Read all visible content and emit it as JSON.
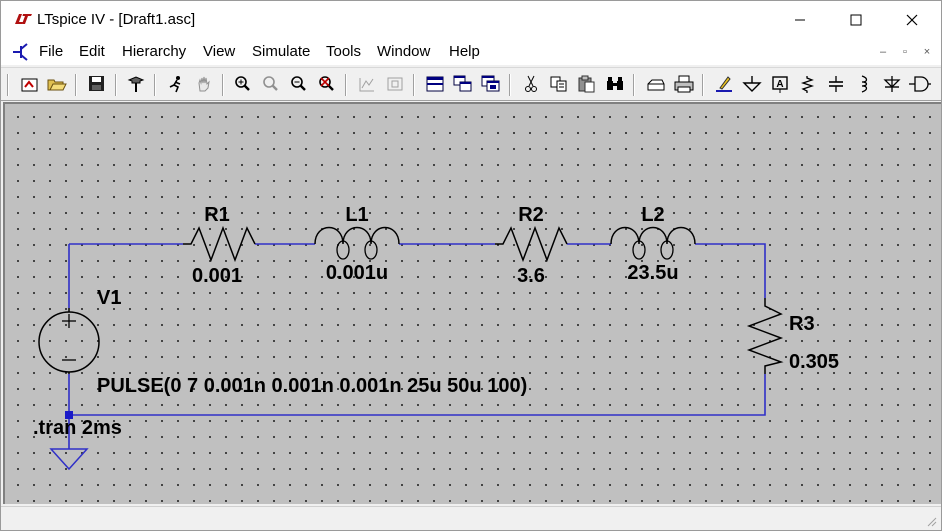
{
  "window": {
    "title": "LTspice IV - [Draft1.asc]"
  },
  "window_controls": {
    "minimize": "—",
    "maximize": "☐",
    "close": "✕"
  },
  "menu": {
    "items": [
      {
        "label": "File"
      },
      {
        "label": "Edit"
      },
      {
        "label": "Hierarchy"
      },
      {
        "label": "View"
      },
      {
        "label": "Simulate"
      },
      {
        "label": "Tools"
      },
      {
        "label": "Window"
      },
      {
        "label": "Help"
      }
    ],
    "mdi_controls": {
      "minimize": "–",
      "restore": "▫",
      "close": "×"
    }
  },
  "toolbar": {
    "icons": [
      "new-schematic-icon",
      "open-icon",
      "save-icon",
      "control-panel-icon",
      "run-icon",
      "halt-icon",
      "zoom-in-icon",
      "zoom-pan-icon",
      "zoom-out-icon",
      "zoom-fit-icon",
      "autorange-icon",
      "view-fit-icon",
      "tile-icon",
      "cascade-icon",
      "close-window-icon",
      "cut-icon",
      "copy-icon",
      "paste-icon",
      "find-icon",
      "print-setup-icon",
      "print-icon",
      "draw-wire-icon",
      "ground-icon",
      "label-net-icon",
      "resistor-icon",
      "capacitor-icon",
      "inductor-icon",
      "diode-icon",
      "component-icon"
    ]
  },
  "schematic": {
    "components": [
      {
        "ref": "R1",
        "value": "0.001",
        "type": "resistor"
      },
      {
        "ref": "L1",
        "value": "0.001u",
        "type": "inductor"
      },
      {
        "ref": "R2",
        "value": "3.6",
        "type": "resistor"
      },
      {
        "ref": "L2",
        "value": "23.5u",
        "type": "inductor"
      },
      {
        "ref": "R3",
        "value": "0.305",
        "type": "resistor"
      },
      {
        "ref": "V1",
        "value": "PULSE(0 7 0.001n 0.001n 0.001n 25u 50u 100)",
        "type": "voltage-source"
      }
    ],
    "directive": ".tran 2ms",
    "wire_color": "#3030c8",
    "grid_color": "#c0c0c0"
  }
}
